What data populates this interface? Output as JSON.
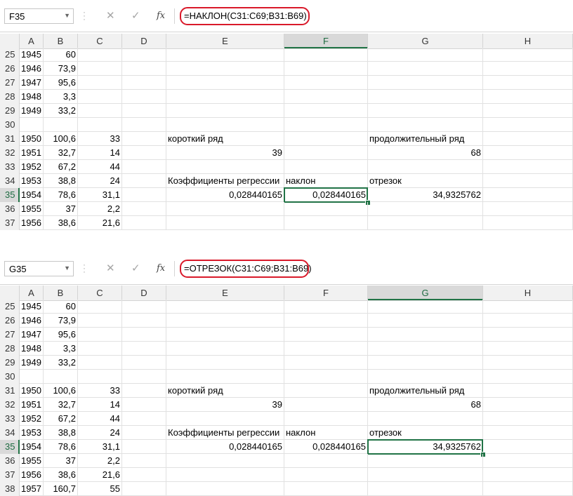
{
  "colors": {
    "accent": "#217346",
    "highlight_oval": "#d9192a"
  },
  "columns": [
    "A",
    "B",
    "C",
    "D",
    "E",
    "F",
    "G",
    "H"
  ],
  "panels": [
    {
      "name_box": "F35",
      "formula": "=НАКЛОН(C31:C69;B31:B69)",
      "selected_column": "F",
      "selected_row": "35",
      "rows": [
        {
          "n": "25",
          "A": "1945",
          "B": "60"
        },
        {
          "n": "26",
          "A": "1946",
          "B": "73,9"
        },
        {
          "n": "27",
          "A": "1947",
          "B": "95,6"
        },
        {
          "n": "28",
          "A": "1948",
          "B": "3,3"
        },
        {
          "n": "29",
          "A": "1949",
          "B": "33,2"
        },
        {
          "n": "30"
        },
        {
          "n": "31",
          "A": "1950",
          "B": "100,6",
          "C": "33",
          "E": "короткий ряд",
          "G": "продолжительный ряд"
        },
        {
          "n": "32",
          "A": "1951",
          "B": "32,7",
          "C": "14",
          "E": "39",
          "G": "68"
        },
        {
          "n": "33",
          "A": "1952",
          "B": "67,2",
          "C": "44"
        },
        {
          "n": "34",
          "A": "1953",
          "B": "38,8",
          "C": "24",
          "E": "Коэффициенты регрессии",
          "F": "наклон",
          "G": "отрезок"
        },
        {
          "n": "35",
          "A": "1954",
          "B": "78,6",
          "C": "31,1",
          "E": "0,028440165",
          "F": "0,028440165",
          "G": "34,9325762"
        },
        {
          "n": "36",
          "A": "1955",
          "B": "37",
          "C": "2,2"
        },
        {
          "n": "37",
          "A": "1956",
          "B": "38,6",
          "C": "21,6"
        }
      ]
    },
    {
      "name_box": "G35",
      "formula": "=ОТРЕЗОК(C31:C69;B31:B69)",
      "selected_column": "G",
      "selected_row": "35",
      "rows": [
        {
          "n": "25",
          "A": "1945",
          "B": "60"
        },
        {
          "n": "26",
          "A": "1946",
          "B": "73,9"
        },
        {
          "n": "27",
          "A": "1947",
          "B": "95,6"
        },
        {
          "n": "28",
          "A": "1948",
          "B": "3,3"
        },
        {
          "n": "29",
          "A": "1949",
          "B": "33,2"
        },
        {
          "n": "30"
        },
        {
          "n": "31",
          "A": "1950",
          "B": "100,6",
          "C": "33",
          "E": "короткий ряд",
          "G": "продолжительный ряд"
        },
        {
          "n": "32",
          "A": "1951",
          "B": "32,7",
          "C": "14",
          "E": "39",
          "G": "68"
        },
        {
          "n": "33",
          "A": "1952",
          "B": "67,2",
          "C": "44"
        },
        {
          "n": "34",
          "A": "1953",
          "B": "38,8",
          "C": "24",
          "E": "Коэффициенты регрессии",
          "F": "наклон",
          "G": "отрезок"
        },
        {
          "n": "35",
          "A": "1954",
          "B": "78,6",
          "C": "31,1",
          "E": "0,028440165",
          "F": "0,028440165",
          "G": "34,9325762"
        },
        {
          "n": "36",
          "A": "1955",
          "B": "37",
          "C": "2,2"
        },
        {
          "n": "37",
          "A": "1956",
          "B": "38,6",
          "C": "21,6"
        },
        {
          "n": "38",
          "A": "1957",
          "B": "160,7",
          "C": "55"
        }
      ]
    }
  ]
}
